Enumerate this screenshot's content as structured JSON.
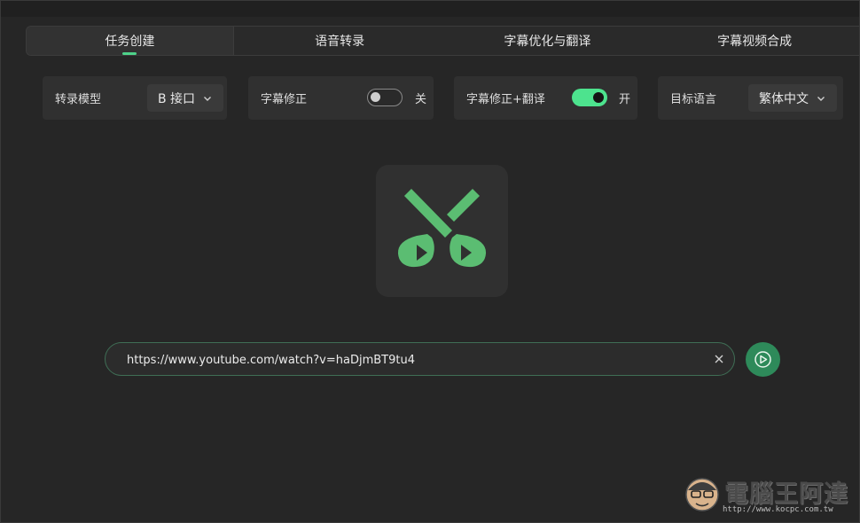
{
  "tabs": [
    {
      "label": "任务创建",
      "active": true
    },
    {
      "label": "语音转录",
      "active": false
    },
    {
      "label": "字幕优化与翻译",
      "active": false
    },
    {
      "label": "字幕视频合成",
      "active": false
    }
  ],
  "settings": {
    "transcribe_model": {
      "label": "转录模型",
      "value": "B 接口"
    },
    "subtitle_fix": {
      "label": "字幕修正",
      "state": "关",
      "enabled": false
    },
    "subtitle_fix_translate": {
      "label": "字幕修正+翻译",
      "state": "开",
      "enabled": true
    },
    "target_language": {
      "label": "目标语言",
      "value": "繁体中文"
    }
  },
  "url_input": {
    "value": "https://www.youtube.com/watch?v=haDjmBT9tu4",
    "placeholder": ""
  },
  "icons": {
    "logo": "scissors-play-icon",
    "clear": "close-icon",
    "submit": "play-icon",
    "dropdown": "chevron-down-icon"
  },
  "colors": {
    "accent": "#4de38e",
    "logo_green": "#5bbd72",
    "submit_bg": "#2e8a5a",
    "background": "#262626"
  },
  "watermark": {
    "title": "電腦王阿達",
    "url": "http://www.kocpc.com.tw"
  }
}
